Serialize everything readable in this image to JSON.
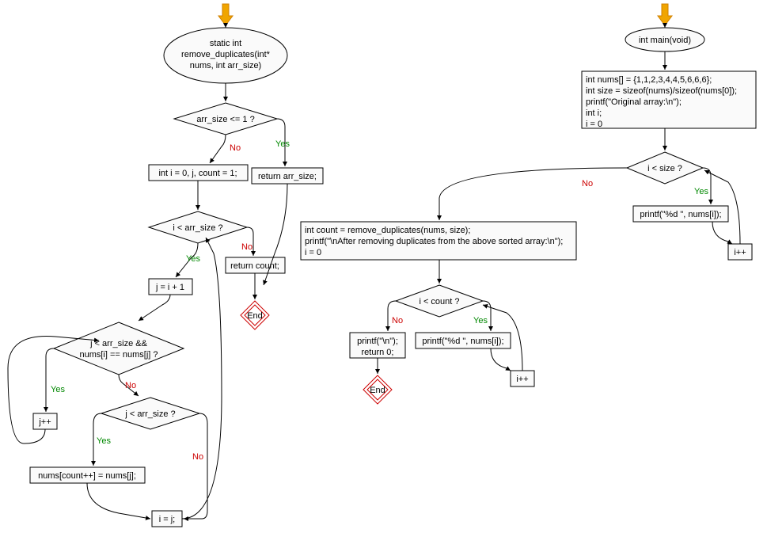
{
  "left": {
    "start_signature": [
      "static int",
      "remove_duplicates(int*",
      "nums, int arr_size)"
    ],
    "cond1": "arr_size <= 1 ?",
    "ret_arrsize": "return arr_size;",
    "init_vars": "int i = 0, j, count = 1;",
    "cond2": "i < arr_size ?",
    "ret_count": "return count;",
    "j_assign": "j = i + 1",
    "cond3": [
      "j < arr_size &&",
      "nums[i] == nums[j] ?"
    ],
    "j_inc": "j++",
    "cond4": "j < arr_size ?",
    "assign_count": "nums[count++] = nums[j];",
    "i_assign": "i = j;",
    "end": "End"
  },
  "right": {
    "main_sig": "int main(void)",
    "init_block": [
      "int nums[] = {1,1,2,3,4,4,5,6,6,6};",
      "int size = sizeof(nums)/sizeof(nums[0]);",
      "printf(\"Original array:\\n\");",
      "int i;",
      "i = 0"
    ],
    "cond_size": "i < size ?",
    "print_num": "printf(\"%d \", nums[i]);",
    "i_inc1": "i++",
    "call_block": [
      "int count = remove_duplicates(nums, size);",
      "printf(\"\\nAfter removing duplicates from the above sorted array:\\n\");",
      "i = 0"
    ],
    "cond_count": "i < count ?",
    "print_num2": "printf(\"%d \", nums[i]);",
    "i_inc2": "i++",
    "final_block": [
      "printf(\"\\n\");",
      "return 0;"
    ],
    "end": "End"
  },
  "labels": {
    "yes": "Yes",
    "no": "No"
  }
}
